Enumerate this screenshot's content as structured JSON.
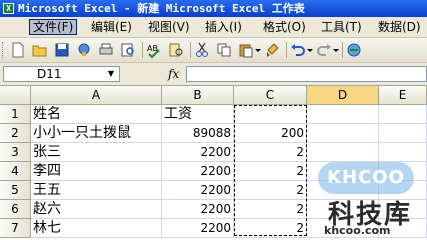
{
  "window": {
    "title": "Microsoft Excel - 新建 Microsoft Excel 工作表",
    "app_icon": "excel-icon"
  },
  "menu": {
    "items": [
      {
        "label": "文件(F)",
        "active": true
      },
      {
        "label": "编辑(E)"
      },
      {
        "label": "视图(V)"
      },
      {
        "label": "插入(I)"
      },
      {
        "label": "格式(O)"
      },
      {
        "label": "工具(T)"
      },
      {
        "label": "数据(D)"
      }
    ]
  },
  "toolbar": {
    "buttons": [
      "new-icon",
      "open-icon",
      "save-icon",
      "permission-icon",
      "print-icon",
      "print-preview-icon",
      "spelling-icon",
      "research-icon",
      "cut-icon",
      "copy-icon",
      "paste-icon",
      "format-painter-icon",
      "undo-icon",
      "redo-icon",
      "hyperlink-icon"
    ]
  },
  "formula_bar": {
    "name_box": "D11",
    "fx_label": "fx",
    "formula": ""
  },
  "sheet": {
    "columns": [
      "A",
      "B",
      "C",
      "D",
      "E"
    ],
    "selected_column": "D",
    "rows": [
      {
        "num": "1",
        "A": "姓名",
        "B": "工资",
        "C": ""
      },
      {
        "num": "2",
        "A": "小小一只土拨鼠",
        "B": "89088",
        "C": "200"
      },
      {
        "num": "3",
        "A": "张三",
        "B": "2200",
        "C": "2"
      },
      {
        "num": "4",
        "A": "李四",
        "B": "2200",
        "C": "2"
      },
      {
        "num": "5",
        "A": "王五",
        "B": "2200",
        "C": "2"
      },
      {
        "num": "6",
        "A": "赵六",
        "B": "2200",
        "C": "2"
      },
      {
        "num": "7",
        "A": "林七",
        "B": "2200",
        "C": "2"
      }
    ],
    "copy_marquee_column": "C"
  },
  "watermark": {
    "logo": "KHCOO",
    "text": "科技库",
    "url": "khcoo.com"
  }
}
